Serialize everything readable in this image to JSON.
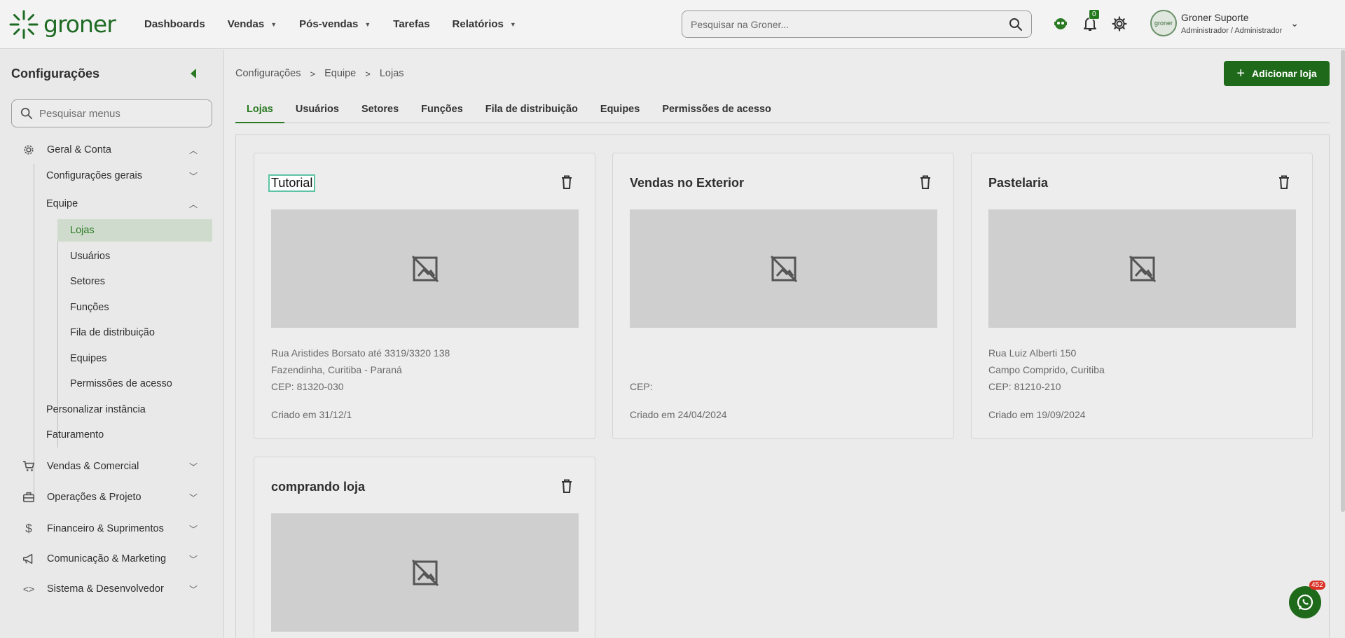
{
  "brand": {
    "name": "groner"
  },
  "nav": [
    {
      "label": "Dashboards"
    },
    {
      "label": "Vendas"
    },
    {
      "label": "Pós-vendas"
    },
    {
      "label": "Tarefas"
    },
    {
      "label": "Relatórios"
    }
  ],
  "search": {
    "placeholder": "Pesquisar na Groner..."
  },
  "notifications": {
    "count": "0"
  },
  "user": {
    "name": "Groner Suporte",
    "role": "Administrador / Administrador",
    "avatar_text": "groner"
  },
  "sidebar": {
    "title": "Configurações",
    "search_placeholder": "Pesquisar menus",
    "geral": "Geral & Conta",
    "config_gerais": "Configurações gerais",
    "equipe": "Equipe",
    "equipe_items": [
      "Lojas",
      "Usuários",
      "Setores",
      "Funções",
      "Fila de distribuição",
      "Equipes",
      "Permissões de acesso"
    ],
    "personalizar": "Personalizar instância",
    "faturamento": "Faturamento",
    "sections": [
      "Vendas & Comercial",
      "Operações & Projeto",
      "Financeiro & Suprimentos",
      "Comunicação & Marketing",
      "Sistema & Desenvolvedor"
    ]
  },
  "breadcrumb": [
    "Configurações",
    "Equipe",
    "Lojas"
  ],
  "add_button": "Adicionar loja",
  "tabs": [
    "Lojas",
    "Usuários",
    "Setores",
    "Funções",
    "Fila de distribuição",
    "Equipes",
    "Permissões de acesso"
  ],
  "stores": [
    {
      "name": "Tutorial",
      "line1": "Rua Aristides Borsato até 3319/3320 138",
      "line2": "Fazendinha, Curitiba - Paraná",
      "cep": "CEP: 81320-030",
      "created": "Criado em 31/12/1"
    },
    {
      "name": "Vendas no Exterior",
      "line1": "",
      "line2": "",
      "cep": "CEP:",
      "created": "Criado em 24/04/2024"
    },
    {
      "name": "Pastelaria",
      "line1": "Rua Luiz Alberti 150",
      "line2": "Campo Comprido, Curitiba",
      "cep": "CEP: 81210-210",
      "created": "Criado em 19/09/2024"
    },
    {
      "name": "comprando loja"
    }
  ],
  "chat": {
    "badge": "452"
  },
  "colors": {
    "brand_green": "#1f6a1a",
    "accent_green": "#2b7a23",
    "active_bg": "#cfdccd"
  }
}
